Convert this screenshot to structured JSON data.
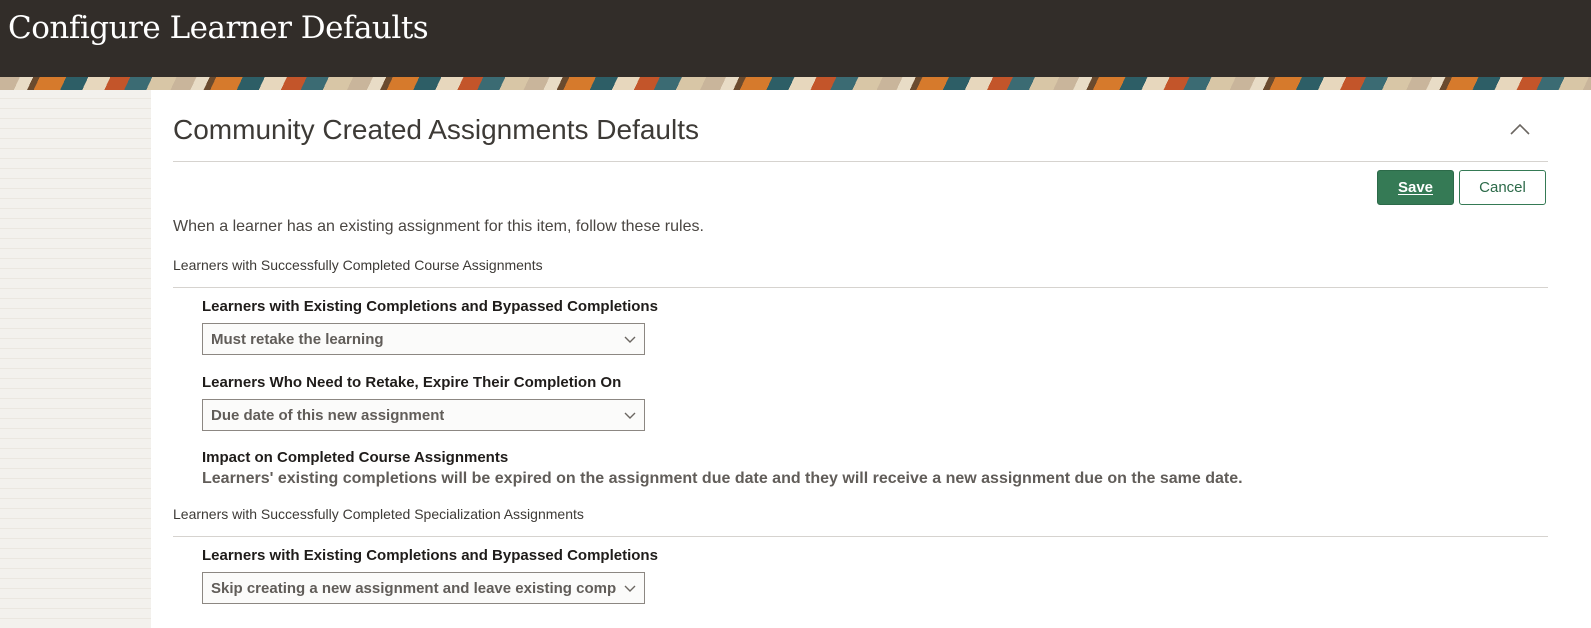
{
  "app": {
    "title": "Configure Learner Defaults"
  },
  "section": {
    "title": "Community Created Assignments Defaults",
    "collapse_icon": "chevron-up-icon"
  },
  "toolbar": {
    "save_label": "Save",
    "cancel_label": "Cancel"
  },
  "intro_text": "When a learner has an existing assignment for this item, follow these rules.",
  "course_group": {
    "heading": "Learners with Successfully Completed Course Assignments",
    "existing_completions": {
      "label": "Learners with Existing Completions and Bypassed Completions",
      "value": "Must retake the learning"
    },
    "expire_on": {
      "label": "Learners Who Need to Retake, Expire Their Completion On",
      "value": "Due date of this new assignment"
    },
    "impact": {
      "label": "Impact on Completed Course Assignments",
      "text": "Learners' existing completions will be expired on the assignment due date and they will receive a new assignment due on the same date."
    }
  },
  "specialization_group": {
    "heading": "Learners with Successfully Completed Specialization Assignments",
    "existing_completions": {
      "label": "Learners with Existing Completions and Bypassed Completions",
      "value": "Skip creating a new assignment and leave existing completions"
    }
  },
  "colors": {
    "header_bg": "#322d29",
    "accent_green": "#357a55"
  }
}
